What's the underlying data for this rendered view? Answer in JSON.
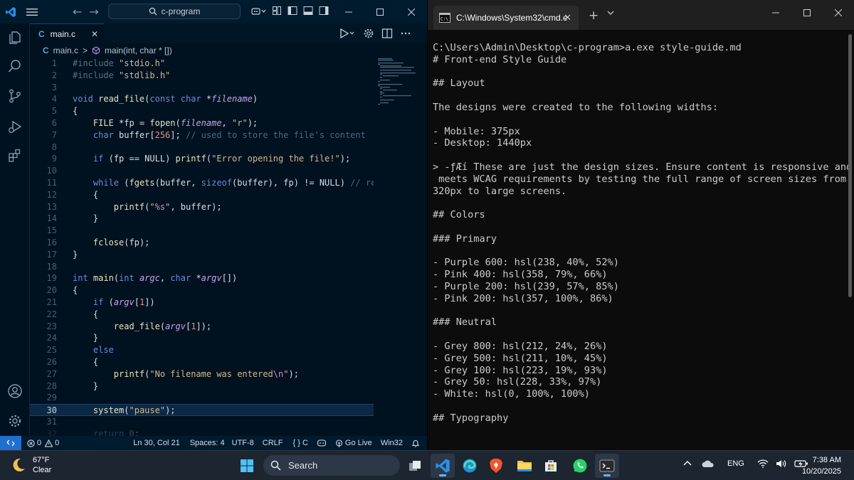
{
  "vscode": {
    "search_text": "c-program",
    "tab": {
      "lang_icon": "C",
      "name": "main.c",
      "close": "✕"
    },
    "breadcrumb": {
      "lang_icon": "C",
      "file": "main.c",
      "sep": ">",
      "symbol": "main(int, char * [])"
    },
    "lines": [
      {
        "n": "1",
        "tokens": [
          [
            "pp",
            "#include "
          ],
          [
            "str",
            "\"stdio.h\""
          ]
        ]
      },
      {
        "n": "2",
        "tokens": [
          [
            "pp",
            "#include "
          ],
          [
            "str",
            "\"stdlib.h\""
          ]
        ]
      },
      {
        "n": "3",
        "tokens": []
      },
      {
        "n": "4",
        "tokens": [
          [
            "kw",
            "void "
          ],
          [
            "fn",
            "read_file"
          ],
          [
            "plain",
            "("
          ],
          [
            "kw",
            "const char "
          ],
          [
            "plain",
            "*"
          ],
          [
            "par",
            "filename"
          ],
          [
            "plain",
            ")"
          ]
        ]
      },
      {
        "n": "5",
        "tokens": [
          [
            "plain",
            "{"
          ]
        ]
      },
      {
        "n": "6",
        "tokens": [
          [
            "plain",
            "    "
          ],
          [
            "type",
            "FILE "
          ],
          [
            "plain",
            "*fp = "
          ],
          [
            "fn",
            "fopen"
          ],
          [
            "plain",
            "("
          ],
          [
            "par",
            "filename"
          ],
          [
            "plain",
            ", "
          ],
          [
            "str",
            "\"r\""
          ],
          [
            "plain",
            ");"
          ]
        ]
      },
      {
        "n": "7",
        "tokens": [
          [
            "plain",
            "    "
          ],
          [
            "kw",
            "char "
          ],
          [
            "plain",
            "buffer["
          ],
          [
            "num",
            "256"
          ],
          [
            "plain",
            "]; "
          ],
          [
            "cm",
            "// used to store the file's content"
          ]
        ]
      },
      {
        "n": "8",
        "tokens": []
      },
      {
        "n": "9",
        "tokens": [
          [
            "plain",
            "    "
          ],
          [
            "kw",
            "if "
          ],
          [
            "plain",
            "(fp == NULL) "
          ],
          [
            "fn",
            "printf"
          ],
          [
            "plain",
            "("
          ],
          [
            "str",
            "\"Error opening the file!\""
          ],
          [
            "plain",
            ");"
          ]
        ]
      },
      {
        "n": "10",
        "tokens": []
      },
      {
        "n": "11",
        "tokens": [
          [
            "plain",
            "    "
          ],
          [
            "kw",
            "while "
          ],
          [
            "plain",
            "("
          ],
          [
            "fn",
            "fgets"
          ],
          [
            "plain",
            "(buffer, "
          ],
          [
            "kw",
            "sizeof"
          ],
          [
            "plain",
            "(buffer), fp) != NULL) "
          ],
          [
            "cm",
            "// reads"
          ]
        ]
      },
      {
        "n": "12",
        "tokens": [
          [
            "plain",
            "    {"
          ]
        ]
      },
      {
        "n": "13",
        "tokens": [
          [
            "plain",
            "        "
          ],
          [
            "fn",
            "printf"
          ],
          [
            "plain",
            "("
          ],
          [
            "str",
            "\""
          ],
          [
            "esc",
            "%s"
          ],
          [
            "str",
            "\""
          ],
          [
            "plain",
            ", buffer);"
          ]
        ]
      },
      {
        "n": "14",
        "tokens": [
          [
            "plain",
            "    }"
          ]
        ]
      },
      {
        "n": "15",
        "tokens": []
      },
      {
        "n": "16",
        "tokens": [
          [
            "plain",
            "    "
          ],
          [
            "fn",
            "fclose"
          ],
          [
            "plain",
            "(fp);"
          ]
        ]
      },
      {
        "n": "17",
        "tokens": [
          [
            "plain",
            "}"
          ]
        ]
      },
      {
        "n": "18",
        "tokens": []
      },
      {
        "n": "19",
        "tokens": [
          [
            "kw",
            "int "
          ],
          [
            "fn",
            "main"
          ],
          [
            "plain",
            "("
          ],
          [
            "kw",
            "int "
          ],
          [
            "par",
            "argc"
          ],
          [
            "plain",
            ", "
          ],
          [
            "kw",
            "char "
          ],
          [
            "plain",
            "*"
          ],
          [
            "par",
            "argv"
          ],
          [
            "plain",
            "[])"
          ]
        ]
      },
      {
        "n": "20",
        "tokens": [
          [
            "plain",
            "{"
          ]
        ]
      },
      {
        "n": "21",
        "tokens": [
          [
            "plain",
            "    "
          ],
          [
            "kw",
            "if "
          ],
          [
            "plain",
            "("
          ],
          [
            "par",
            "argv"
          ],
          [
            "plain",
            "["
          ],
          [
            "num",
            "1"
          ],
          [
            "plain",
            "])"
          ]
        ]
      },
      {
        "n": "22",
        "tokens": [
          [
            "plain",
            "    {"
          ]
        ]
      },
      {
        "n": "23",
        "tokens": [
          [
            "plain",
            "        "
          ],
          [
            "fn",
            "read_file"
          ],
          [
            "plain",
            "("
          ],
          [
            "par",
            "argv"
          ],
          [
            "plain",
            "["
          ],
          [
            "num",
            "1"
          ],
          [
            "plain",
            "]);"
          ]
        ]
      },
      {
        "n": "24",
        "tokens": [
          [
            "plain",
            "    }"
          ]
        ]
      },
      {
        "n": "25",
        "tokens": [
          [
            "plain",
            "    "
          ],
          [
            "kw",
            "else"
          ]
        ]
      },
      {
        "n": "26",
        "tokens": [
          [
            "plain",
            "    {"
          ]
        ]
      },
      {
        "n": "27",
        "tokens": [
          [
            "plain",
            "        "
          ],
          [
            "fn",
            "printf"
          ],
          [
            "plain",
            "("
          ],
          [
            "str",
            "\"No filename was entered"
          ],
          [
            "esc",
            "\\n"
          ],
          [
            "str",
            "\""
          ],
          [
            "plain",
            ");"
          ]
        ]
      },
      {
        "n": "28",
        "tokens": [
          [
            "plain",
            "    }"
          ]
        ]
      },
      {
        "n": "29",
        "tokens": []
      },
      {
        "n": "30",
        "tokens": [
          [
            "plain",
            "    "
          ],
          [
            "fn",
            "system"
          ],
          [
            "plain",
            "("
          ],
          [
            "str",
            "\"pause\""
          ],
          [
            "plain",
            ");"
          ]
        ],
        "active": true
      },
      {
        "n": "31",
        "tokens": []
      },
      {
        "n": "32",
        "tokens": [
          [
            "plain",
            "    "
          ],
          [
            "kw",
            "return "
          ],
          [
            "num",
            "0"
          ],
          [
            "plain",
            ";"
          ]
        ],
        "faded": true
      }
    ],
    "status": {
      "errors": "0",
      "warnings": "0",
      "position": "Ln 30, Col 21",
      "spaces": "Spaces: 4",
      "encoding": "UTF-8",
      "eol": "CRLF",
      "braces": "{ }",
      "language": "C",
      "golive": "Go Live",
      "platform": "Win32"
    },
    "accent": "#1f6fd0"
  },
  "terminal": {
    "tab_title": "C:\\Windows\\System32\\cmd.e",
    "lines": [
      "C:\\Users\\Admin\\Desktop\\c-program>a.exe style-guide.md",
      "# Front-end Style Guide",
      "",
      "## Layout",
      "",
      "The designs were created to the following widths:",
      "",
      "- Mobile: 375px",
      "- Desktop: 1440px",
      "",
      "> ‑ƒÆí These are just the design sizes. Ensure content is responsive and",
      " meets WCAG requirements by testing the full range of screen sizes from",
      "320px to large screens.",
      "",
      "## Colors",
      "",
      "### Primary",
      "",
      "- Purple 600: hsl(238, 40%, 52%)",
      "- Pink 400: hsl(358, 79%, 66%)",
      "- Purple 200: hsl(239, 57%, 85%)",
      "- Pink 200: hsl(357, 100%, 86%)",
      "",
      "### Neutral",
      "",
      "- Grey 800: hsl(212, 24%, 26%)",
      "- Grey 500: hsl(211, 10%, 45%)",
      "- Grey 100: hsl(223, 19%, 93%)",
      "- Grey 50: hsl(228, 33%, 97%)",
      "- White: hsl(0, 100%, 100%)",
      "",
      "## Typography"
    ]
  },
  "taskbar": {
    "weather_temp": "67°F",
    "weather_desc": "Clear",
    "search_label": "Search",
    "lang": "ENG",
    "time": "7:38 AM",
    "date": "10/20/2025"
  }
}
